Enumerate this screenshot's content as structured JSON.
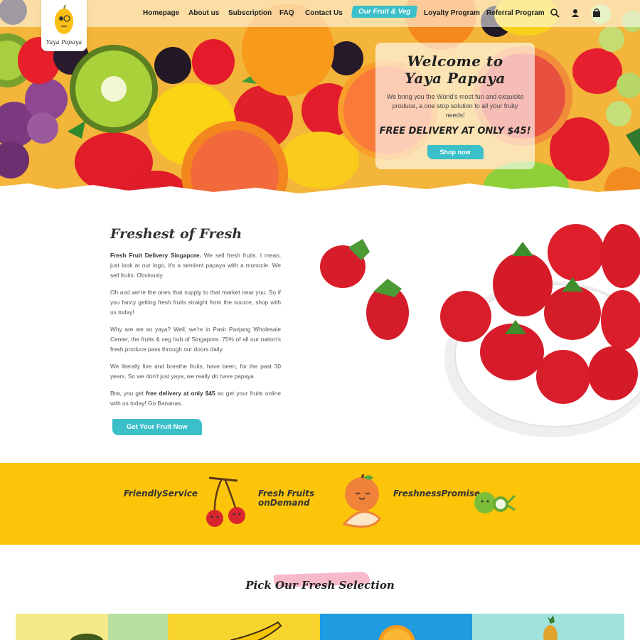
{
  "brand": {
    "logo_text": "Yaya Papaya"
  },
  "nav": {
    "items": [
      {
        "label": "Homepage"
      },
      {
        "label": "About us"
      },
      {
        "label": "Subscription"
      },
      {
        "label": "FAQ"
      },
      {
        "label": "Contact Us"
      },
      {
        "label": "Our Fruit & Veg"
      },
      {
        "label": "Loyalty Program"
      },
      {
        "label": "Referral Program"
      }
    ],
    "active_index": 5,
    "icons": [
      "search-icon",
      "account-icon",
      "cart-icon"
    ]
  },
  "hero": {
    "title": "Welcome to Yaya Papaya",
    "subtitle": "We bring you the World's most fun and exquisite produce, a one stop solution to all your fruity needs!",
    "promo": "FREE DELIVERY AT ONLY $45!",
    "cta": "Shop now"
  },
  "about": {
    "heading": "Freshest of Fresh",
    "p1_bold": "Fresh Fruit Delivery Singapore.",
    "p1_rest": " We sell fresh fruits. I mean, just look at our logo, it's a sentient papaya with a monocle. We sell fruits. Obviously.",
    "p2": "Oh and we're the ones that supply to that market near you. So if you fancy getting fresh fruits straight from the source, shop with us today!",
    "p3": "Why are we so yaya? Well, we're in Pasir Panjang Wholesale Center, the fruits & veg hub of Singapore. 75% of all our nation's fresh produce pass through our doors daily.",
    "p4": "We literally live and breathe fruits, have been, for the past 30 years. So we don't just yaya, we really do have papaya.",
    "p5_pre": "Btw, you get ",
    "p5_bold": "free delivery at only $45",
    "p5_post": " so get your fruits online with us today! Go Bananas.",
    "cta": "Get Your Fruit Now"
  },
  "features": [
    {
      "label": "FriendlyService",
      "icon": "cherries-icon"
    },
    {
      "label_line1": "Fresh Fruits",
      "label_line2": "onDemand",
      "icon": "apple-character-icon"
    },
    {
      "label": "FreshnessPromise",
      "icon": "coconut-icon"
    }
  ],
  "selection": {
    "title": "Pick Our Fresh Selection",
    "tiles": [
      {
        "name": "avocado-tile",
        "color": "#f4ea8a"
      },
      {
        "name": "banana-tile",
        "color": "#f8d42e"
      },
      {
        "name": "orange-tile",
        "color": "#1f9be0"
      },
      {
        "name": "pineapple-tile",
        "color": "#9fe3dc"
      }
    ]
  },
  "colors": {
    "accent": "#3bbfc9",
    "yellow": "#fcc50a",
    "pink": "#f4a9bd"
  }
}
